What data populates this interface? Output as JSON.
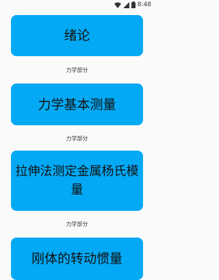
{
  "status_bar": {
    "time": "8:48",
    "icons": [
      "wifi-icon",
      "signal-icon",
      "battery-icon"
    ]
  },
  "colors": {
    "card_bg": "#03a9f4",
    "page_bg": "#fafafa"
  },
  "items": [
    {
      "title": "绪论",
      "section": "力学部分"
    },
    {
      "title": "力学基本测量",
      "section": "力学部分"
    },
    {
      "title": "拉伸法测定金属杨氏模量",
      "section": "力学部分"
    },
    {
      "title": "刚体的转动惯量"
    }
  ]
}
